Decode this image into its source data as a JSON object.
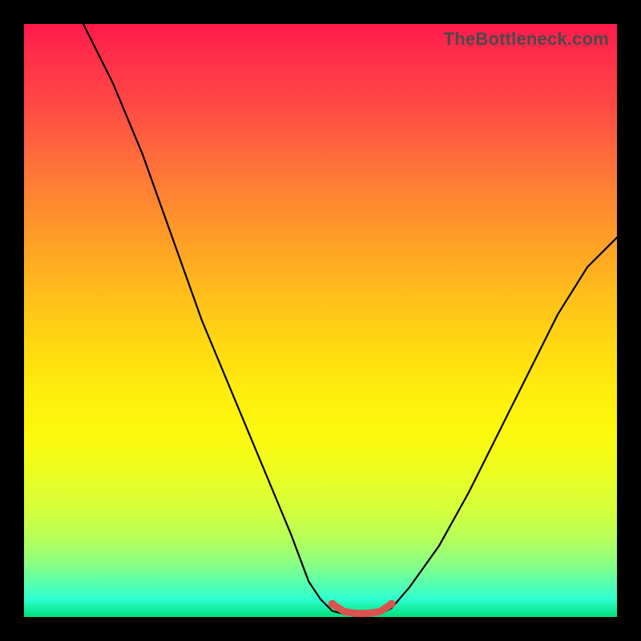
{
  "watermark": "TheBottleneck.com",
  "chart_data": {
    "type": "line",
    "title": "",
    "xlabel": "",
    "ylabel": "",
    "xlim": [
      0,
      100
    ],
    "ylim": [
      0,
      100
    ],
    "series": [
      {
        "name": "bottleneck-curve",
        "color": "#000000",
        "stroke_width": 2.2,
        "x": [
          10,
          15,
          20,
          25,
          30,
          35,
          40,
          45,
          48,
          50,
          52,
          54,
          56,
          58,
          60,
          62,
          65,
          70,
          75,
          80,
          85,
          90,
          95,
          100
        ],
        "y": [
          100,
          90,
          78,
          64,
          50,
          38,
          26,
          14,
          6,
          3,
          1,
          0.5,
          0.5,
          0.5,
          0.5,
          1.5,
          5,
          12,
          21,
          31,
          41,
          51,
          59,
          64
        ]
      },
      {
        "name": "optimal-zone",
        "color": "#d9534f",
        "stroke_width": 9,
        "x": [
          52,
          54,
          56,
          58,
          60,
          62
        ],
        "y": [
          2.2,
          0.9,
          0.6,
          0.6,
          0.9,
          2.2
        ]
      }
    ]
  }
}
